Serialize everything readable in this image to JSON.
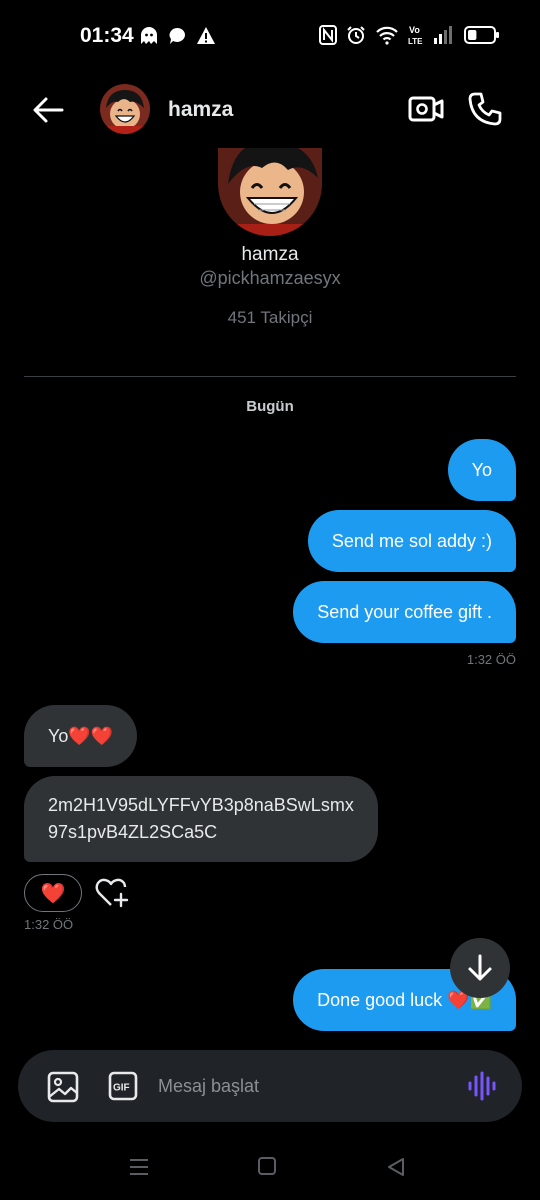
{
  "status_bar": {
    "time": "01:34",
    "battery_level": 0.35
  },
  "header": {
    "name": "hamza"
  },
  "profile": {
    "name": "hamza",
    "handle": "@pickhamzaesyx",
    "followers": "451 Takipçi"
  },
  "day_label": "Bugün",
  "messages": {
    "sent_1": "Yo",
    "sent_2": "Send me sol addy :)",
    "sent_3": "Send your coffee gift .",
    "sent_time": "1:32 ÖÖ",
    "recv_1": "Yo❤️❤️",
    "recv_2_line1": "2m2H1V95dLYFFvYB3p8naBSwLsmx",
    "recv_2_line2": "97s1pvB4ZL2SCa5C",
    "recv_reaction": "❤️",
    "recv_time": "1:32 ÖÖ",
    "sent_4": "Done good luck ❤️✅"
  },
  "composer": {
    "placeholder": "Mesaj başlat"
  },
  "colors": {
    "accent": "#1d9bf0",
    "voice_icon": "#7856ff",
    "received_bubble": "#2f3336"
  },
  "icons": {
    "back": "arrow-left-icon",
    "video": "video-camera-icon",
    "call": "phone-icon",
    "image": "image-icon",
    "gif": "gif-icon",
    "voice": "voice-wave-icon",
    "scroll": "arrow-down-icon",
    "add_reaction": "heart-plus-icon"
  }
}
